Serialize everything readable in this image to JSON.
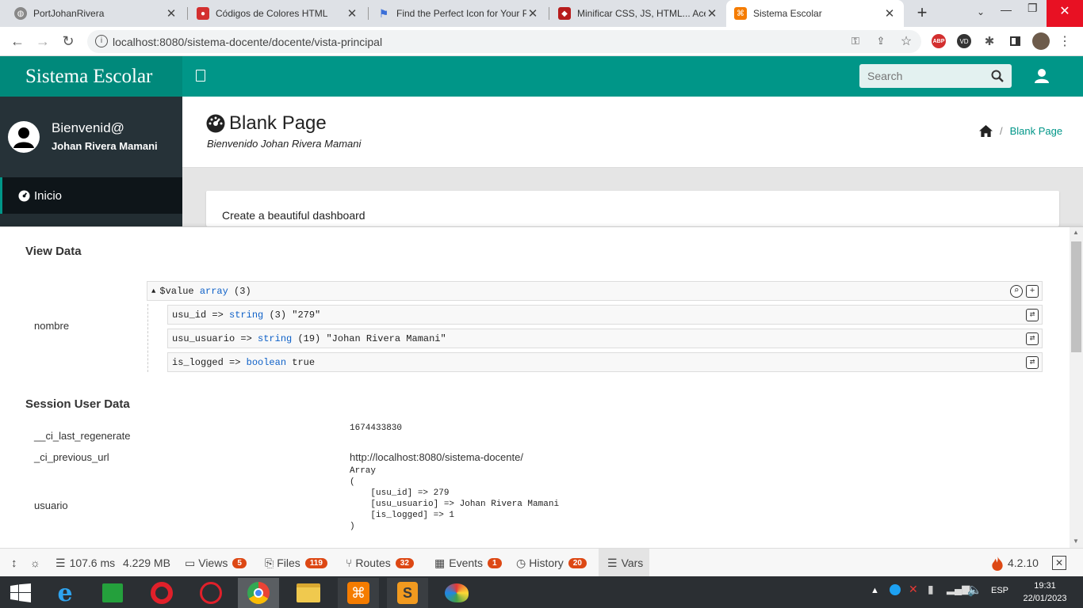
{
  "browser": {
    "tabs": [
      {
        "title": "PortJohanRivera",
        "active": false
      },
      {
        "title": "Códigos de Colores HTML",
        "active": false
      },
      {
        "title": "Find the Perfect Icon for Your P",
        "active": false
      },
      {
        "title": "Minificar CSS, JS, HTML... Acele",
        "active": false
      },
      {
        "title": "Sistema Escolar",
        "active": true
      }
    ],
    "new_tab_glyph": "+",
    "url": "localhost:8080/sistema-docente/docente/vista-principal"
  },
  "app": {
    "brand": "Sistema Escolar",
    "search_placeholder": "Search",
    "sidebar": {
      "welcome": "Bienvenid@",
      "user_name": "Johan Rivera Mamani",
      "menu": [
        {
          "label": "Inicio",
          "icon": "dashboard-icon"
        }
      ]
    },
    "page_title": "Blank Page",
    "page_subtitle": "Bienvenido Johan Rivera Mamani",
    "breadcrumb": {
      "separator": "/",
      "current": "Blank Page"
    },
    "card_text": "Create a beautiful dashboard"
  },
  "debug": {
    "view_data_title": "View Data",
    "var_label": "nombre",
    "var_header": {
      "name": "$value",
      "type": "array",
      "count": "(3)"
    },
    "entries": [
      {
        "key": "usu_id =>",
        "type": "string",
        "meta": "(3)",
        "value": "\"279\""
      },
      {
        "key": "usu_usuario =>",
        "type": "string",
        "meta": "(19)",
        "value": "\"Johan Rivera Mamani\""
      },
      {
        "key": "is_logged =>",
        "type": "boolean",
        "meta": "",
        "value": "true"
      }
    ],
    "session_title": "Session User Data",
    "session": [
      {
        "key": "__ci_last_regenerate",
        "value": "1674433830"
      },
      {
        "key": "_ci_previous_url",
        "value": "http://localhost:8080/sistema-docente/"
      },
      {
        "key": "usuario",
        "value": "Array\n(\n    [usu_id] => 279\n    [usu_usuario] => Johan Rivera Mamani\n    [is_logged] => 1\n)"
      }
    ]
  },
  "toolbar": {
    "time": "107.6 ms",
    "memory": "4.229 MB",
    "items": [
      {
        "label": "Views",
        "count": "5"
      },
      {
        "label": "Files",
        "count": "119"
      },
      {
        "label": "Routes",
        "count": "32"
      },
      {
        "label": "Events",
        "count": "1"
      },
      {
        "label": "History",
        "count": "20"
      },
      {
        "label": "Vars",
        "count": ""
      }
    ],
    "version": "4.2.10",
    "close_glyph": "✕"
  },
  "taskbar": {
    "lang": "ESP",
    "time": "19:31",
    "date": "22/01/2023"
  },
  "colors": {
    "teal": "#009688",
    "teal_dark": "#00897b",
    "sidebar": "#222d32",
    "badge": "#dd4814"
  }
}
